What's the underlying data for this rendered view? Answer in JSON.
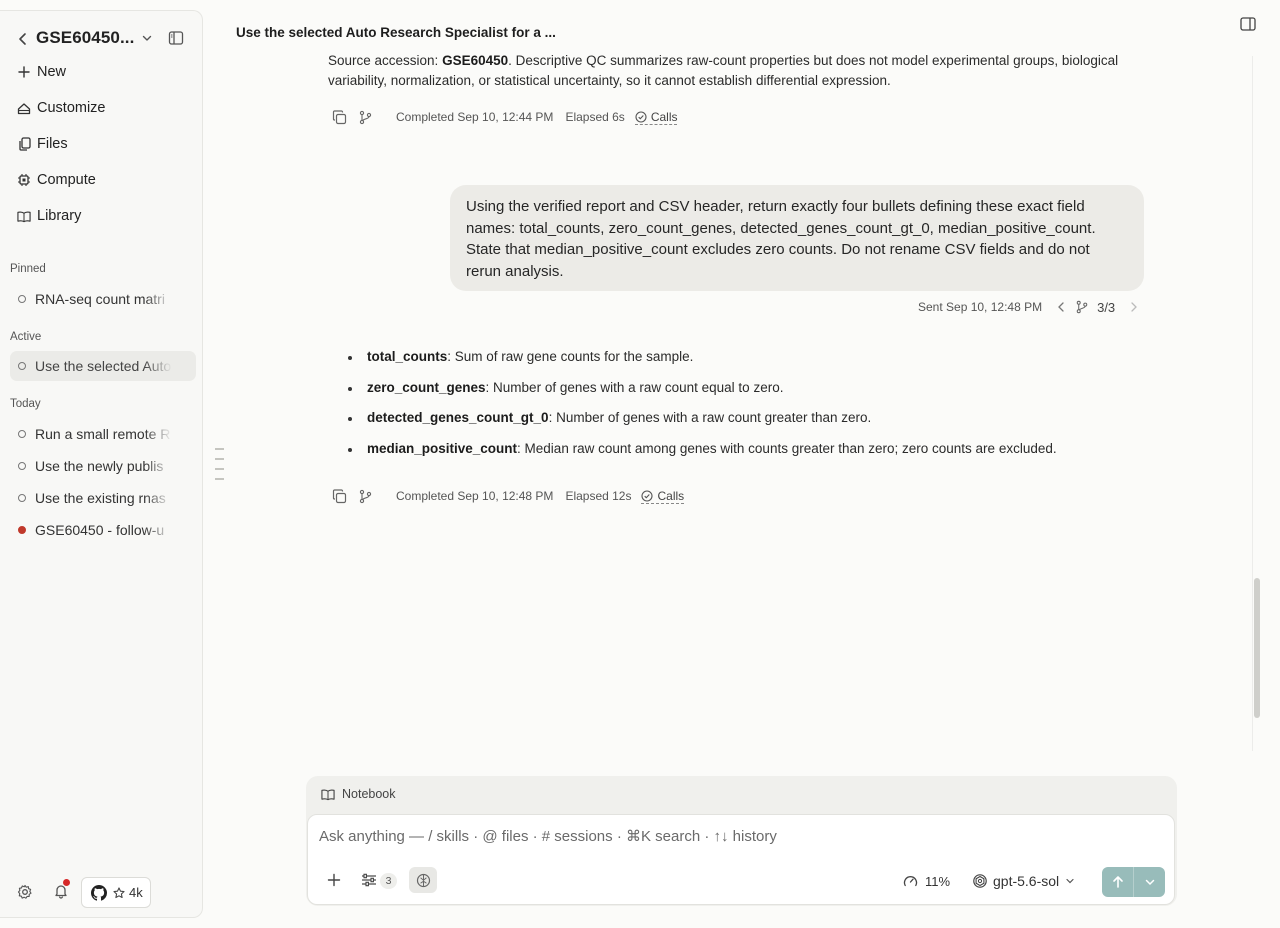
{
  "sidebar": {
    "title": "GSE60450...",
    "nav": [
      {
        "label": "New",
        "icon": "plus-icon"
      },
      {
        "label": "Customize",
        "icon": "customize-icon"
      },
      {
        "label": "Files",
        "icon": "files-icon"
      },
      {
        "label": "Compute",
        "icon": "cpu-icon"
      },
      {
        "label": "Library",
        "icon": "book-icon"
      }
    ],
    "sections": {
      "pinned": "Pinned",
      "active": "Active",
      "today": "Today"
    },
    "pinned_items": [
      "RNA-seq count matri"
    ],
    "active_items": [
      "Use the selected Auto"
    ],
    "today_items": [
      {
        "label": "Run a small remote R",
        "status": "idle"
      },
      {
        "label": "Use the newly publis",
        "status": "idle"
      },
      {
        "label": "Use the existing rnas",
        "status": "idle"
      },
      {
        "label": "GSE60450 - follow-u",
        "status": "error"
      }
    ],
    "github_stars": "4k"
  },
  "topbar": {
    "title": "Use the selected Auto Research Specialist for a ..."
  },
  "previous_message": {
    "prefix": "Source accession: ",
    "accession": "GSE60450",
    "text": ". Descriptive QC summarizes raw-count properties but does not model experimental groups, biological variability, normalization, or statistical uncertainty, so it cannot establish differential expression.",
    "completed": "Completed Sep 10, 12:44 PM",
    "elapsed": "Elapsed 6s",
    "calls": "Calls"
  },
  "user_message": {
    "text": "Using the verified report and CSV header, return exactly four bullets defining these exact field names: total_counts, zero_count_genes, detected_genes_count_gt_0, median_positive_count. State that median_positive_count excludes zero counts. Do not rename CSV fields and do not rerun analysis.",
    "sent": "Sent Sep 10, 12:48 PM",
    "branch": "3/3"
  },
  "assistant_message": {
    "bullets": [
      {
        "term": "total_counts",
        "desc": ": Sum of raw gene counts for the sample."
      },
      {
        "term": "zero_count_genes",
        "desc": ": Number of genes with a raw count equal to zero."
      },
      {
        "term": "detected_genes_count_gt_0",
        "desc": ": Number of genes with a raw count greater than zero."
      },
      {
        "term": "median_positive_count",
        "desc": ": Median raw count among genes with counts greater than zero; zero counts are excluded."
      }
    ],
    "completed": "Completed Sep 10, 12:48 PM",
    "elapsed": "Elapsed 12s",
    "calls": "Calls"
  },
  "composer": {
    "tab": "Notebook",
    "placeholder": "Ask anything — / skills · @ files · # sessions · ⌘K search · ↑↓ history",
    "tools_count": "3",
    "context_pct": "11%",
    "model": "gpt-5.6-sol"
  },
  "colors": {
    "send_button": "#98bcba",
    "error_dot": "#c0392b",
    "notification_dot": "#d62828"
  }
}
